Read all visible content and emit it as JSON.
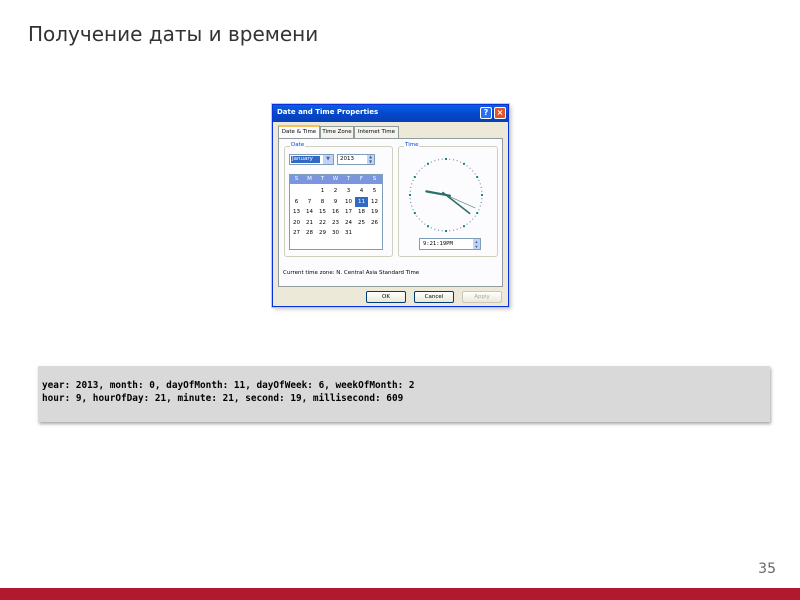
{
  "slide": {
    "title": "Получение даты и времени",
    "page_number": "35",
    "accent_color": "#b0192f"
  },
  "dialog": {
    "title": "Date and Time Properties",
    "help_label": "?",
    "close_label": "×",
    "tabs": [
      {
        "label": "Date & Time",
        "active": true
      },
      {
        "label": "Time Zone",
        "active": false
      },
      {
        "label": "Internet Time",
        "active": false
      }
    ],
    "date_group_label": "Date",
    "time_group_label": "Time",
    "month": "January",
    "year": "2013",
    "day_headers": [
      "S",
      "M",
      "T",
      "W",
      "T",
      "F",
      "S"
    ],
    "weeks": [
      [
        "",
        "",
        "1",
        "2",
        "3",
        "4",
        "5"
      ],
      [
        "6",
        "7",
        "8",
        "9",
        "10",
        "11",
        "12"
      ],
      [
        "13",
        "14",
        "15",
        "16",
        "17",
        "18",
        "19"
      ],
      [
        "20",
        "21",
        "22",
        "23",
        "24",
        "25",
        "26"
      ],
      [
        "27",
        "28",
        "29",
        "30",
        "31",
        "",
        ""
      ]
    ],
    "selected_day": "11",
    "time": "9:21:19PM",
    "timezone_text": "Current time zone:  N. Central Asia Standard Time",
    "ok_label": "OK",
    "cancel_label": "Cancel",
    "apply_label": "Apply",
    "clock": {
      "hour": 21,
      "minute": 21,
      "second": 19,
      "hand_color": "#2f6f6a"
    }
  },
  "code": {
    "lines": [
      "year: 2013, month: 0, dayOfMonth: 11, dayOfWeek: 6, weekOfMonth: 2",
      "hour: 9, hourOfDay: 21, minute: 21, second: 19, millisecond: 609"
    ]
  }
}
